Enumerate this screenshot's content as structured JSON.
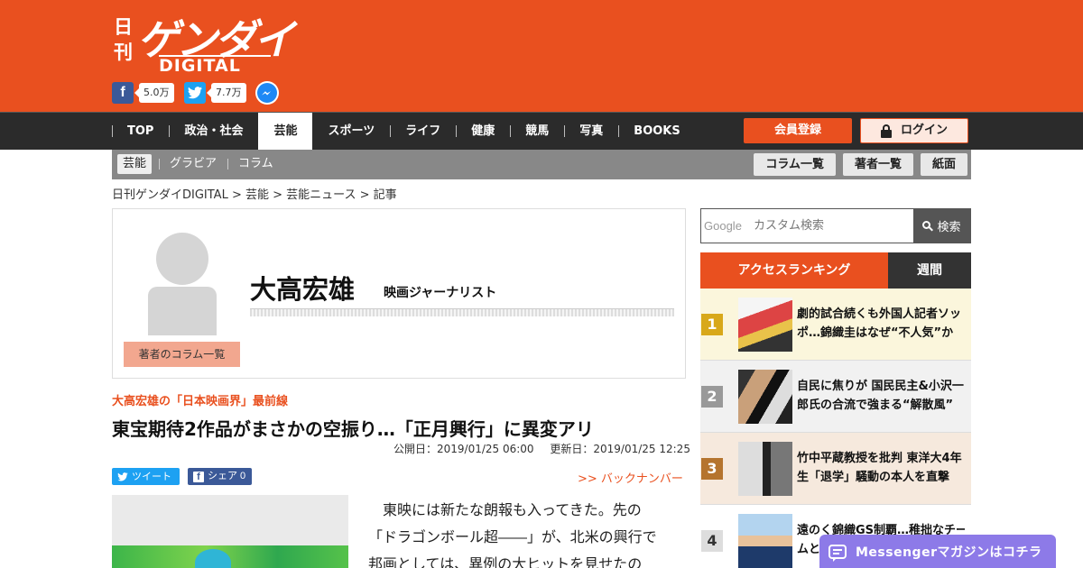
{
  "logo": {
    "nikkan": "日刊",
    "gendai": "ゲンダイ",
    "digital": "DIGITAL"
  },
  "social": {
    "facebook_count": "5.0万",
    "twitter_count": "7.7万"
  },
  "nav": {
    "items": [
      "TOP",
      "政治・社会",
      "芸能",
      "スポーツ",
      "ライフ",
      "健康",
      "競馬",
      "写真",
      "BOOKS"
    ],
    "active": "芸能",
    "register": "会員登録",
    "login": "ログイン"
  },
  "subnav": {
    "left": [
      "芸能",
      "グラビア",
      "コラム"
    ],
    "right": [
      "コラム一覧",
      "著者一覧",
      "紙面"
    ]
  },
  "breadcrumb": "日刊ゲンダイDIGITAL > 芸能 > 芸能ニュース > 記事",
  "author": {
    "name": "大高宏雄",
    "title": "映画ジャーナリスト",
    "columns_button": "著者のコラム一覧"
  },
  "article": {
    "series": "大高宏雄の「日本映画界」最前線",
    "headline": "東宝期待2作品がまさかの空振り…「正月興行」に異変アリ",
    "published": "公開日：2019/01/25 06:00",
    "updated": "更新日：2019/01/25 12:25",
    "tweet": "ツイート",
    "share": "シェア 0",
    "backnumber": ">> バックナンバー",
    "body": [
      "　東映には新たな朗報も入ってきた。先の",
      "「ドラゴンボール超――」が、北米の興行で",
      "邦画としては、異例の大ヒットを見せたの"
    ]
  },
  "search": {
    "google_label": "Google",
    "placeholder": "カスタム検索",
    "button": "検索"
  },
  "ranking": {
    "tab_access": "アクセスランキング",
    "tab_weekly": "週間",
    "items": [
      {
        "rank": "1",
        "lines": [
          "劇的試合続くも外国人記者ソッ",
          "ポ…錦織圭はなぜ“不人気”か"
        ]
      },
      {
        "rank": "2",
        "lines": [
          "自民に焦りが 国民民主&小沢一",
          "郎氏の合流で強まる“解散風”"
        ]
      },
      {
        "rank": "3",
        "lines": [
          "竹中平蔵教授を批判 東洋大4年",
          "生「退学」騒動の本人を直撃"
        ]
      },
      {
        "rank": "4",
        "lines": [
          "遠のく錦織GS制覇…稚拙なチー",
          "ムと"
        ]
      }
    ],
    "colors": [
      "#d8a81a",
      "#999999",
      "#b5742e",
      "#dddddd"
    ],
    "backgrounds": [
      "#fbf6dc",
      "#f1f1f1",
      "#f6e9dd",
      "#ffffff"
    ]
  },
  "messenger": "Messengerマガジンはコチラ",
  "colors": {
    "brand": "#e9501f",
    "nav_bg": "#2b2b2b",
    "messenger": "#8d7ae8"
  }
}
